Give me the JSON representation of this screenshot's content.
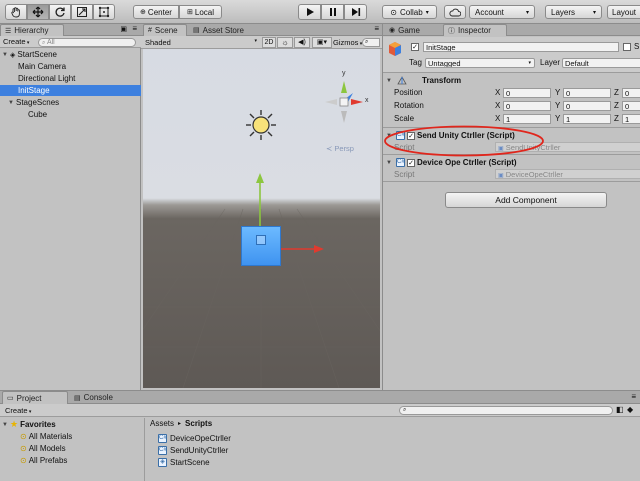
{
  "toolbar": {
    "center_label": "Center",
    "local_label": "Local",
    "collab_label": "Collab",
    "account_label": "Account",
    "layers_label": "Layers",
    "layout_label": "Layout"
  },
  "hierarchy": {
    "tab_label": "Hierarchy",
    "create_label": "Create",
    "search_placeholder": "All",
    "items": [
      {
        "label": "StartScene"
      },
      {
        "label": "Main Camera"
      },
      {
        "label": "Directional Light"
      },
      {
        "label": "InitStage"
      },
      {
        "label": "StageScnes"
      },
      {
        "label": "Cube"
      }
    ]
  },
  "scene": {
    "tab_label": "Scene",
    "asset_store_label": "Asset Store",
    "shading_mode": "Shaded",
    "mode_2d": "2D",
    "gizmos_label": "Gizmos",
    "persp_label": "Persp",
    "gizmo_axes": {
      "x": "x",
      "y": "y"
    }
  },
  "game": {
    "tab_label": "Game"
  },
  "inspector": {
    "tab_label": "Inspector",
    "object_name": "InitStage",
    "static_label": "S",
    "tag_label": "Tag",
    "tag_value": "Untagged",
    "layer_label": "Layer",
    "layer_value": "Default",
    "transform": {
      "title": "Transform",
      "rows": [
        {
          "label": "Position",
          "x": "0",
          "y": "0",
          "z": "0"
        },
        {
          "label": "Rotation",
          "x": "0",
          "y": "0",
          "z": "0"
        },
        {
          "label": "Scale",
          "x": "1",
          "y": "1",
          "z": "1"
        }
      ],
      "axis_x": "X",
      "axis_y": "Y",
      "axis_z": "Z"
    },
    "components": [
      {
        "title": "Send Unity Ctrller (Script)",
        "script_label": "Script",
        "script_value": "SendUnityCtrller"
      },
      {
        "title": "Device Ope Ctrller (Script)",
        "script_label": "Script",
        "script_value": "DeviceOpeCtrller"
      }
    ],
    "add_component_label": "Add Component",
    "highlight_color": "#e0261c"
  },
  "project": {
    "tab_label": "Project",
    "console_label": "Console",
    "create_label": "Create",
    "favorites_label": "Favorites",
    "favorites": [
      {
        "label": "All Materials"
      },
      {
        "label": "All Models"
      },
      {
        "label": "All Prefabs"
      }
    ],
    "breadcrumb_root": "Assets",
    "breadcrumb_current": "Scripts",
    "files": [
      {
        "label": "DeviceOpeCtrller"
      },
      {
        "label": "SendUnityCtrller"
      },
      {
        "label": "StartScene"
      }
    ]
  },
  "colors": {
    "accent": "#3d80df",
    "sky": "#d9dde5",
    "ground": "#5f5a56",
    "cube": "#4aa3ff"
  }
}
